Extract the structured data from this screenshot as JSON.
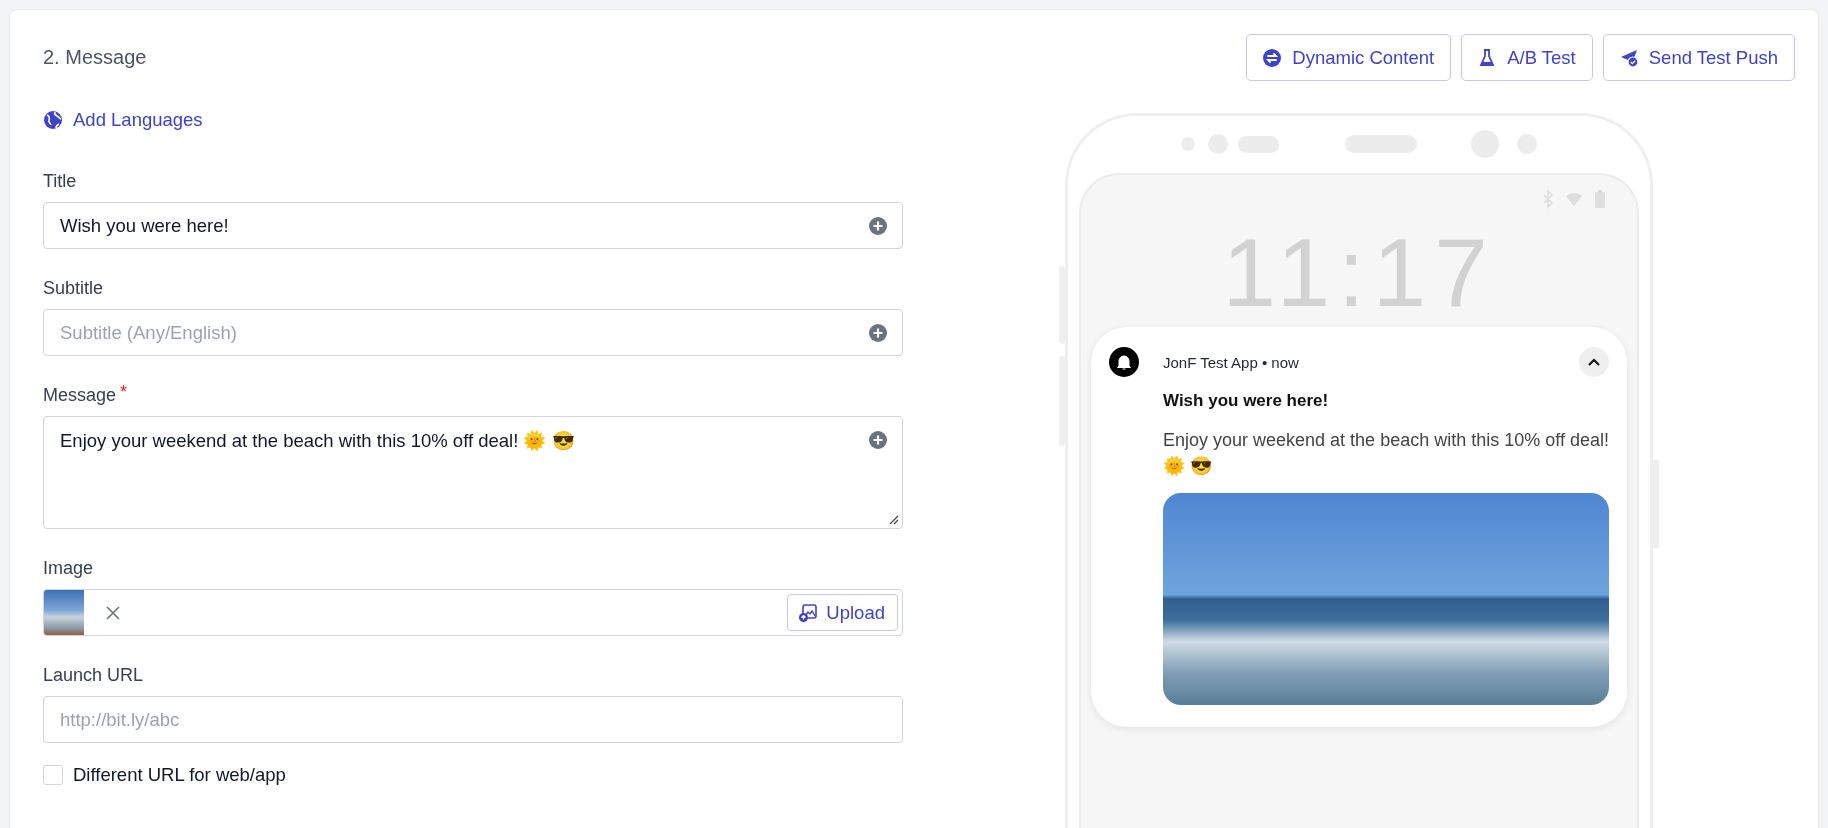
{
  "section": {
    "title": "2. Message"
  },
  "toolbar": [
    {
      "kind": "dynamic",
      "label": "Dynamic Content"
    },
    {
      "kind": "flask",
      "label": "A/B Test"
    },
    {
      "kind": "send",
      "label": "Send Test Push"
    }
  ],
  "add_languages": {
    "label": "Add Languages"
  },
  "fields": [
    {
      "kind": "text",
      "label": "Title",
      "value": "Wish you were here!"
    },
    {
      "kind": "text",
      "label": "Subtitle",
      "placeholder": "Subtitle (Any/English)"
    },
    {
      "kind": "textarea",
      "label": "Message",
      "required_mark": "*",
      "value": "Enjoy your weekend at the beach with this 10% off deal! 🌞 😎"
    },
    {
      "kind": "image",
      "label": "Image",
      "button": "Upload"
    },
    {
      "kind": "url",
      "label": "Launch URL",
      "placeholder": "http://bit.ly/abc"
    }
  ],
  "checkbox": {
    "label": "Different URL for web/app",
    "checked": false
  },
  "preview": {
    "clock": "11:17",
    "app": "JonF Test App • now",
    "expanded": true,
    "title": "Wish you were here!",
    "body": "Enjoy your weekend at the beach with this 10% off deal! 🌞 😎"
  }
}
